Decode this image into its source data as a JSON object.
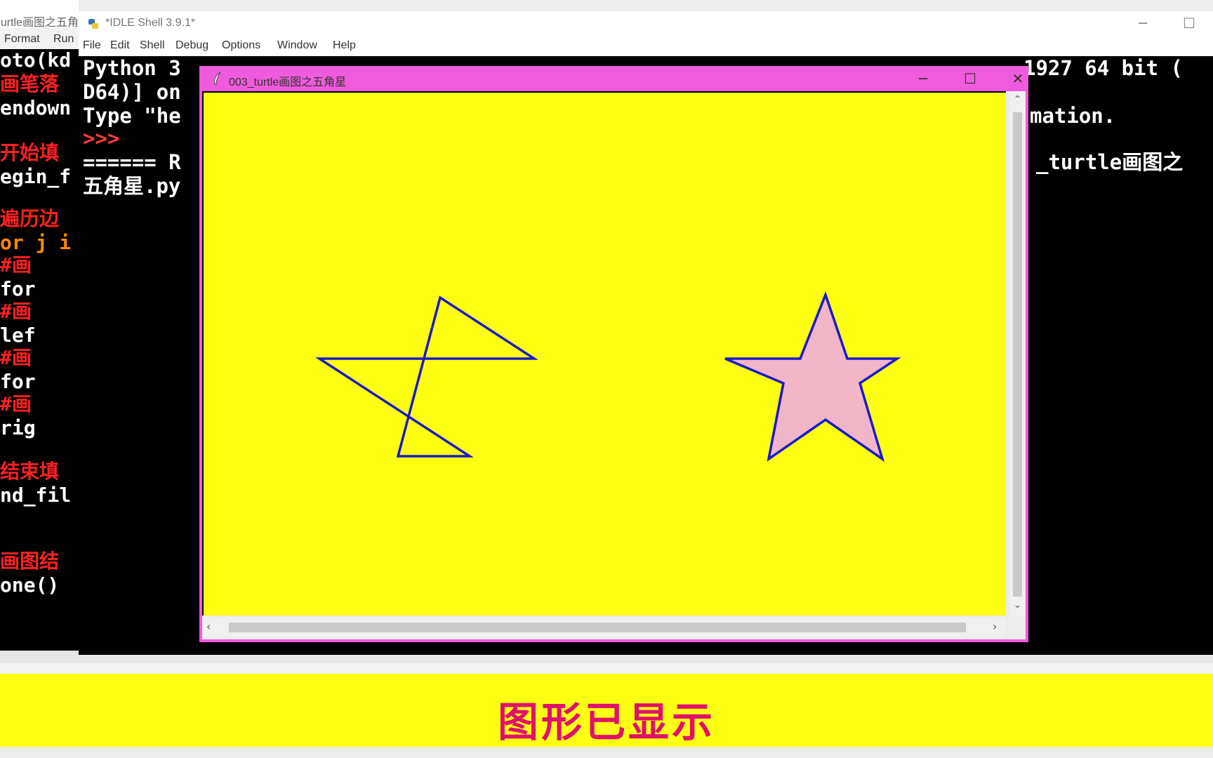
{
  "editor": {
    "title": "urtle画图之五角",
    "menu": [
      "Format",
      "Run"
    ],
    "code_lines": [
      {
        "text": "oto(kd",
        "color": "w"
      },
      {
        "text": "画笔落",
        "color": "r"
      },
      {
        "text": "endown",
        "color": "w"
      },
      {
        "text": "开始填",
        "color": "r"
      },
      {
        "text": "egin_f",
        "color": "w"
      },
      {
        "text": "遍历边",
        "color": "r"
      },
      {
        "text": "or j i",
        "color": "o"
      },
      {
        "text": "  #画",
        "color": "r"
      },
      {
        "text": "  for",
        "color": "w"
      },
      {
        "text": "  #画",
        "color": "r"
      },
      {
        "text": "  lef",
        "color": "w"
      },
      {
        "text": "  #画",
        "color": "r"
      },
      {
        "text": "  for",
        "color": "w"
      },
      {
        "text": "  #画",
        "color": "r"
      },
      {
        "text": "  rig",
        "color": "w"
      },
      {
        "text": "结束填",
        "color": "r"
      },
      {
        "text": "nd_fil",
        "color": "w"
      },
      {
        "text": "画图结",
        "color": "r"
      },
      {
        "text": "one()",
        "color": "w"
      }
    ]
  },
  "shell": {
    "title": "*IDLE Shell 3.9.1*",
    "menu": [
      "File",
      "Edit",
      "Shell",
      "Debug",
      "Options",
      "Window",
      "Help"
    ],
    "lines_left": [
      "Python 3",
      "D64)] on",
      "Type \"he",
      ">>>",
      "====== R",
      "五角星.py"
    ],
    "lines_right": [
      "1927 64 bit (",
      "mation.",
      "_turtle画图之"
    ],
    "minimize": "─",
    "maximize": "☐"
  },
  "turtle": {
    "title": "003_turtle画图之五角星",
    "minimize": "─",
    "maximize": "☐",
    "close": "✕",
    "canvas_color": "#ffff12",
    "pen_color": "#1a1ac8",
    "fill_color": "#f0b6c8"
  },
  "caption": {
    "text": "图形已显示",
    "color": "#e0106b"
  }
}
